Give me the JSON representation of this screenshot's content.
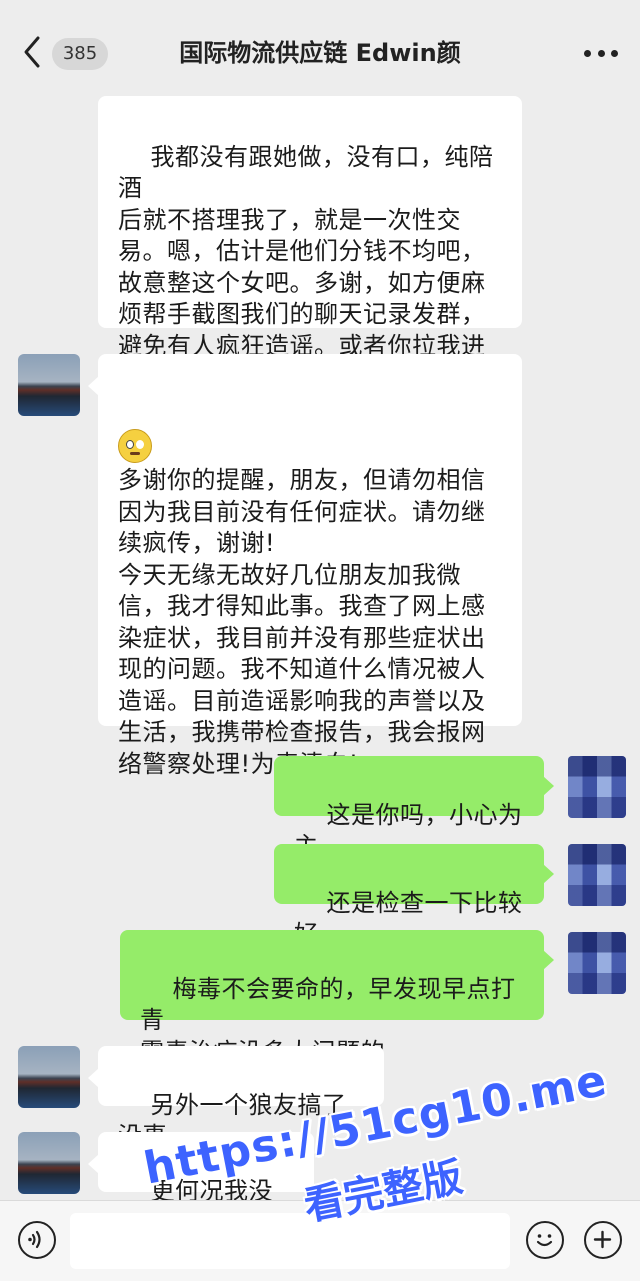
{
  "header": {
    "unread_count": "385",
    "title": "国际物流供应链 Edwin颜"
  },
  "messages": [
    {
      "side": "in",
      "text": "我都没有跟她做，没有口，纯陪酒\n后就不搭理我了，就是一次性交\n易。嗯，估计是他们分钱不均吧，\n故意整这个女吧。多谢，如方便麻\n烦帮手截图我们的聊天记录发群，\n避免有人疯狂造谣。或者你拉我进\n群?"
    },
    {
      "side": "in",
      "emoji": "face-emoji",
      "text": "多谢你的提醒，朋友，但请勿相信\n因为我目前没有任何症状。请勿继\n续疯传，谢谢!\n今天无缘无故好几位朋友加我微\n信，我才得知此事。我查了网上感\n染症状，我目前并没有那些症状出\n现的问题。我不知道什么情况被人\n造谣。目前造谣影响我的声誉以及\n生活，我携带检查报告，我会报网\n络警察处理!为表清白!"
    },
    {
      "side": "out",
      "text": "这是你吗，小心为主"
    },
    {
      "side": "out",
      "text": "还是检查一下比较好"
    },
    {
      "side": "out",
      "text": "梅毒不会要命的，早发现早点打青\n霉素治疗没多大问题的"
    },
    {
      "side": "in",
      "text": "另外一个狼友搞了没事，"
    },
    {
      "side": "in",
      "text": "更何况我没有搞"
    }
  ],
  "watermark": {
    "url": "https://51cg10.me",
    "caption": "看完整版"
  },
  "colors": {
    "background": "#ededed",
    "incoming_bubble": "#ffffff",
    "outgoing_bubble": "#95ec69",
    "watermark": "#3d63ff"
  }
}
